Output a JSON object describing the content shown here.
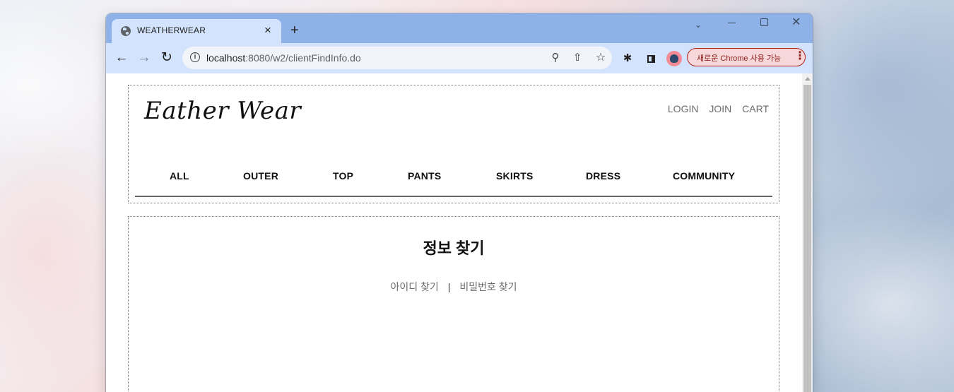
{
  "browser": {
    "tab_title": "WEATHERWEAR",
    "tab_close": "×",
    "new_tab": "+",
    "url_host": "localhost",
    "url_path": ":8080/w2/clientFindInfo.do",
    "update_button": "새로운 Chrome 사용 가능",
    "menu_dots": "⋮",
    "icons": [
      "globe-icon",
      "back-icon",
      "forward-icon",
      "reload-icon",
      "info-icon",
      "zoom-icon",
      "share-icon",
      "star-icon",
      "extensions-icon",
      "side-panel-icon"
    ]
  },
  "site": {
    "logo": "Eather Wear",
    "util_links": [
      "LOGIN",
      "JOIN",
      "CART"
    ],
    "categories": [
      "ALL",
      "OUTER",
      "TOP",
      "PANTS",
      "SKIRTS",
      "DRESS",
      "COMMUNITY"
    ]
  },
  "main": {
    "title": "정보 찾기",
    "find_id": "아이디 찾기",
    "separator": "|",
    "find_password": "비밀번호 찾기"
  }
}
